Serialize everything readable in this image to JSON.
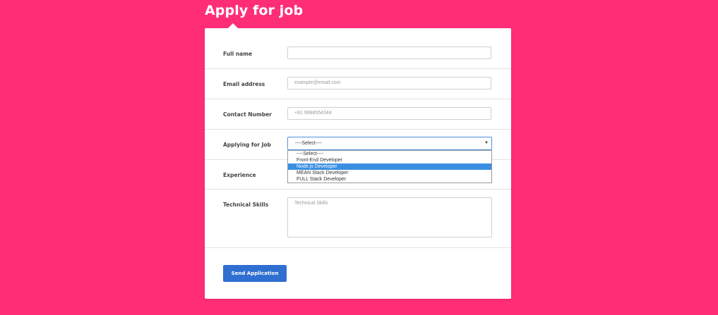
{
  "page": {
    "title": "Apply for job"
  },
  "form": {
    "full_name": {
      "label": "Full name",
      "value": "",
      "placeholder": ""
    },
    "email": {
      "label": "Email address",
      "placeholder": "example@email.com"
    },
    "contact": {
      "label": "Contact Number",
      "placeholder": "+91 9988554344"
    },
    "job": {
      "label": "Applying for Job",
      "selected": "----Select----",
      "options": [
        "----Select----",
        "Front-End Developer",
        "Node.js Developer",
        "MEAN Stack Developer",
        "FULL Stack Developer"
      ],
      "highlighted_option": "Node.js Developer"
    },
    "experience": {
      "label": "Experience"
    },
    "skills": {
      "label": "Technical Skills",
      "placeholder": "Technical Skills"
    },
    "submit_label": "Send Application"
  },
  "colors": {
    "background": "#ff2d78",
    "button": "#2f6fd1",
    "highlight": "#3b8fe3"
  }
}
